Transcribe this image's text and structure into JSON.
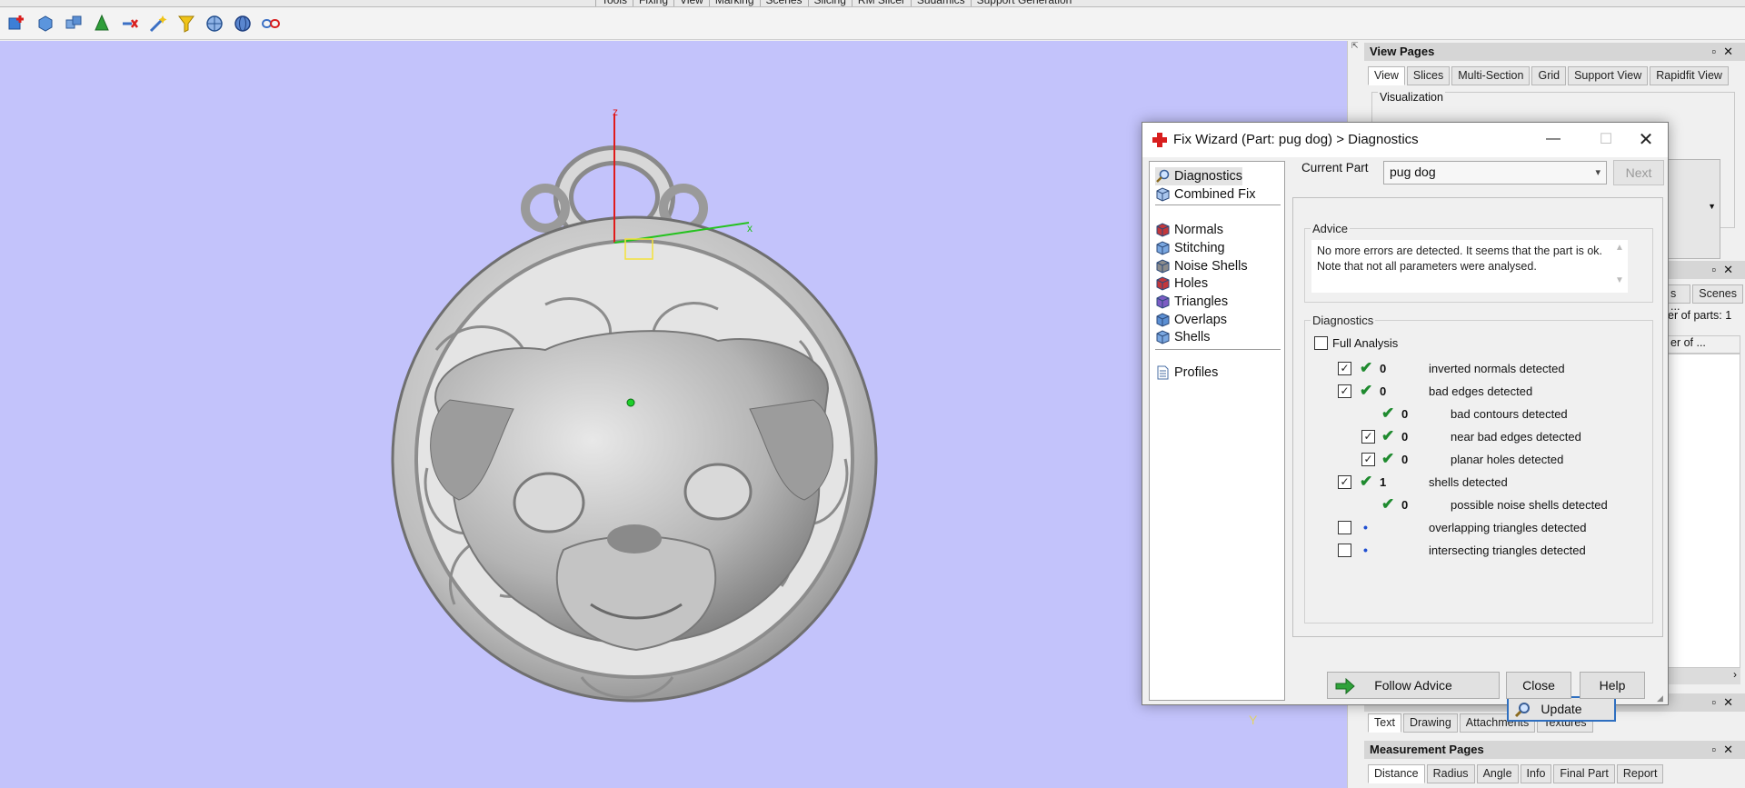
{
  "ribbon": {
    "tabs": [
      "Tools",
      "Fixing",
      "View",
      "Marking",
      "Scenes",
      "Slicing",
      "RM Slicer",
      "Sudamics",
      "Support Generation"
    ],
    "toolbar_icons": [
      "add-part-icon",
      "unload-icon",
      "parts-icon",
      "cone-icon",
      "remove-icon",
      "fix-wizard-icon",
      "filter-icon",
      "view-front-icon",
      "view-sphere-icon",
      "link-icon"
    ]
  },
  "viewport": {
    "axis_z": "z",
    "axis_x": "x",
    "axis_y": "Y",
    "background_color": "#c3c3fb"
  },
  "view_pages": {
    "title": "View Pages",
    "tabs": [
      "View",
      "Slices",
      "Multi-Section",
      "Grid",
      "Support View",
      "Rapidfit View"
    ],
    "active_tab": "View",
    "visualization_label": "Visualization"
  },
  "scenes_panel": {
    "tabs": [
      "s ...",
      "Scenes"
    ],
    "line1": "er of parts: 1",
    "line2": "er of ..."
  },
  "text_panel": {
    "tabs": [
      "Text",
      "Drawing",
      "Attachments",
      "Textures"
    ],
    "active_tab": "Text"
  },
  "measurement_pages": {
    "title": "Measurement Pages",
    "tabs": [
      "Distance",
      "Radius",
      "Angle",
      "Info",
      "Final Part",
      "Report"
    ],
    "active_tab": "Distance"
  },
  "dialog": {
    "title": "Fix Wizard (Part: pug dog) > Diagnostics",
    "nav": [
      {
        "label": "Diagnostics",
        "icon": "magnifier-icon",
        "selected": true
      },
      {
        "label": "Combined Fix",
        "icon": "cube-icon",
        "selected": false
      },
      {
        "label": "Normals",
        "icon": "normals-cube-icon",
        "selected": false
      },
      {
        "label": "Stitching",
        "icon": "stitching-cube-icon",
        "selected": false
      },
      {
        "label": "Noise Shells",
        "icon": "noise-shells-icon",
        "selected": false
      },
      {
        "label": "Holes",
        "icon": "holes-cube-icon",
        "selected": false
      },
      {
        "label": "Triangles",
        "icon": "triangles-cube-icon",
        "selected": false
      },
      {
        "label": "Overlaps",
        "icon": "overlaps-cube-icon",
        "selected": false
      },
      {
        "label": "Shells",
        "icon": "shells-cube-icon",
        "selected": false
      },
      {
        "label": "Profiles",
        "icon": "document-icon",
        "selected": false
      }
    ],
    "current_part_label": "Current Part",
    "current_part_value": "pug dog",
    "next_label": "Next",
    "advice_group": "Advice",
    "advice_text": "No more errors are detected. It seems that the part is ok. Note that not all parameters were analysed.",
    "diagnostics_group": "Diagnostics",
    "full_analysis_label": "Full Analysis",
    "full_analysis_checked": false,
    "rows": [
      {
        "checkbox": true,
        "checked": true,
        "status": "ok",
        "count": "0",
        "label": "inverted normals detected",
        "indent": false
      },
      {
        "checkbox": true,
        "checked": true,
        "status": "ok",
        "count": "0",
        "label": "bad edges detected",
        "indent": false
      },
      {
        "checkbox": false,
        "checked": false,
        "status": "ok",
        "count": "0",
        "label": "bad contours detected",
        "indent": true
      },
      {
        "checkbox": true,
        "checked": true,
        "status": "ok",
        "count": "0",
        "label": "near bad edges detected",
        "indent": true
      },
      {
        "checkbox": true,
        "checked": true,
        "status": "ok",
        "count": "0",
        "label": "planar holes detected",
        "indent": true
      },
      {
        "checkbox": true,
        "checked": true,
        "status": "ok",
        "count": "1",
        "label": "shells detected",
        "indent": false
      },
      {
        "checkbox": false,
        "checked": false,
        "status": "ok",
        "count": "0",
        "label": "possible noise shells detected",
        "indent": true
      },
      {
        "checkbox": true,
        "checked": false,
        "status": "pending",
        "count": "",
        "label": "overlapping triangles detected",
        "indent": false
      },
      {
        "checkbox": true,
        "checked": false,
        "status": "pending",
        "count": "",
        "label": "intersecting triangles detected",
        "indent": false
      }
    ],
    "update_label": "Update",
    "follow_advice_label": "Follow Advice",
    "close_label": "Close",
    "help_label": "Help"
  }
}
